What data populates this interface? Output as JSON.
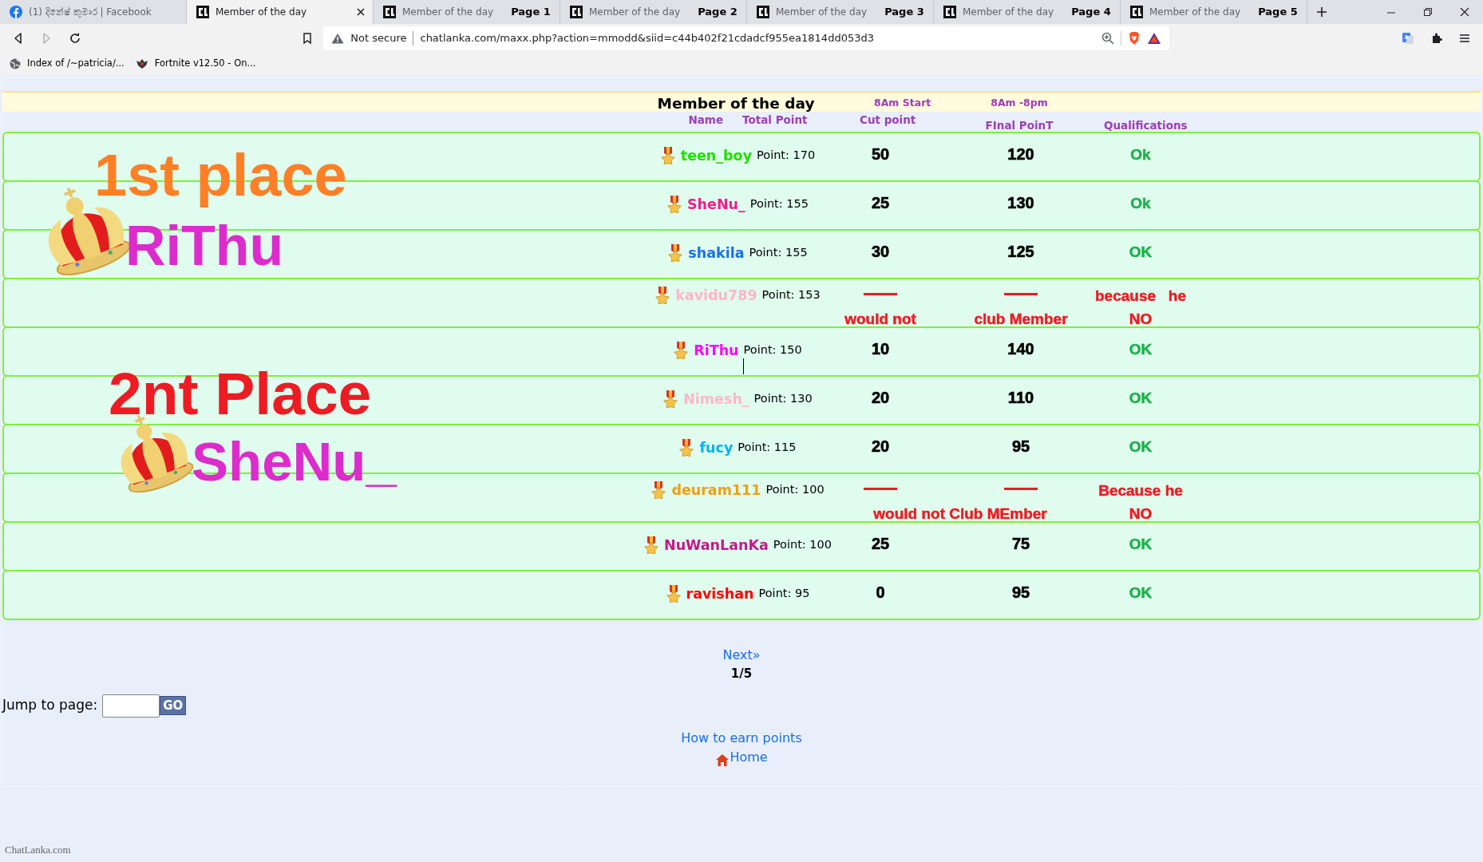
{
  "browser": {
    "tabs": [
      {
        "title": "(1) දිනේෂ් කුමාර | Facebook",
        "selected": false
      },
      {
        "title": "Member of the day",
        "selected": true
      },
      {
        "title": "Member of the day",
        "page_label": "Page 1",
        "selected": false
      },
      {
        "title": "Member of the day",
        "page_label": "Page 2",
        "selected": false
      },
      {
        "title": "Member of the day",
        "page_label": "Page 3",
        "selected": false
      },
      {
        "title": "Member of the day",
        "page_label": "Page 4",
        "selected": false
      },
      {
        "title": "Member of the day",
        "page_label": "Page 5",
        "selected": false
      }
    ],
    "address": {
      "security": "Not secure",
      "url": "chatlanka.com/maxx.php?action=mmodd&siid=c44b402f21cdadcf955ea1814dd053d3"
    },
    "bookmarks": [
      {
        "title": "Index of /~patricia/..."
      },
      {
        "title": "Fortnite v12.50 - On..."
      }
    ]
  },
  "page": {
    "title": "Member of the day",
    "headers": {
      "name": "Name",
      "total": "Total Point",
      "cut_top": "8Am Start",
      "cut": "Cut point",
      "final_top": "8Am -8pm",
      "final": "FInal PoinT",
      "qualification": "Qualifications"
    },
    "rows": [
      {
        "name": "teen_boy",
        "color": "#22dd00",
        "points": "Point: 170",
        "kind": "scored",
        "cut": "50",
        "final": "120",
        "qualification": "Ok"
      },
      {
        "name": "SheNu_",
        "color": "#f01e8c",
        "points": "Point: 155",
        "kind": "scored",
        "cut": "25",
        "final": "130",
        "qualification": "Ok"
      },
      {
        "name": "shakila",
        "color": "#1a6fe8",
        "points": "Point: 155",
        "kind": "scored",
        "cut": "30",
        "final": "125",
        "qualification": "OK"
      },
      {
        "name": "kavidu789",
        "color": "#ffb6c8",
        "points": "Point: 153",
        "kind": "rejected",
        "reason": "because   he",
        "verdict": "NO",
        "notes": [
          "would not",
          "club Member"
        ]
      },
      {
        "name": "RiThu",
        "color": "#ff00ff",
        "points": "Point: 150",
        "kind": "scored",
        "cut": "10",
        "final": "140",
        "qualification": "OK"
      },
      {
        "name": "Nimesh_",
        "color": "#ffb6c8",
        "points": "Point: 130",
        "kind": "scored",
        "cut": "20",
        "final": "110",
        "qualification": "OK"
      },
      {
        "name": "fucy",
        "color": "#00b4f0",
        "points": "Point: 115",
        "kind": "scored",
        "cut": "20",
        "final": "95",
        "qualification": "OK"
      },
      {
        "name": "deuram111",
        "color": "#f0a010",
        "points": "Point: 100",
        "kind": "rejected",
        "reason": "Because he",
        "verdict": "NO",
        "notes": [
          "would not Club MEmber"
        ]
      },
      {
        "name": "NuWanLanKa",
        "color": "#c8188c",
        "points": "Point: 100",
        "kind": "scored",
        "cut": "25",
        "final": "75",
        "qualification": "OK"
      },
      {
        "name": "ravishan",
        "color": "#ff0000",
        "points": "Point: 95",
        "kind": "scored",
        "cut": "0",
        "final": "95",
        "qualification": "OK"
      }
    ],
    "overlays": [
      {
        "kind": "caption",
        "text": "1st place",
        "color": "#ff7f27"
      },
      {
        "kind": "crown"
      },
      {
        "kind": "caption",
        "text": "RiThu",
        "color": "#dd2ccc"
      },
      {
        "kind": "caption",
        "text": "2nt Place",
        "color": "#ed1c24"
      },
      {
        "kind": "crown"
      },
      {
        "kind": "caption",
        "text": "SheNu_",
        "color": "#dd2ccc"
      }
    ],
    "pager": {
      "next": "Next»",
      "position": "1/5"
    },
    "jump": {
      "label": "Jump to page:",
      "button": "GO"
    },
    "links": [
      {
        "text": "How to earn points",
        "kind": "plain"
      },
      {
        "text": "Home",
        "kind": "home"
      }
    ],
    "logo": "ChatLanka.com"
  }
}
